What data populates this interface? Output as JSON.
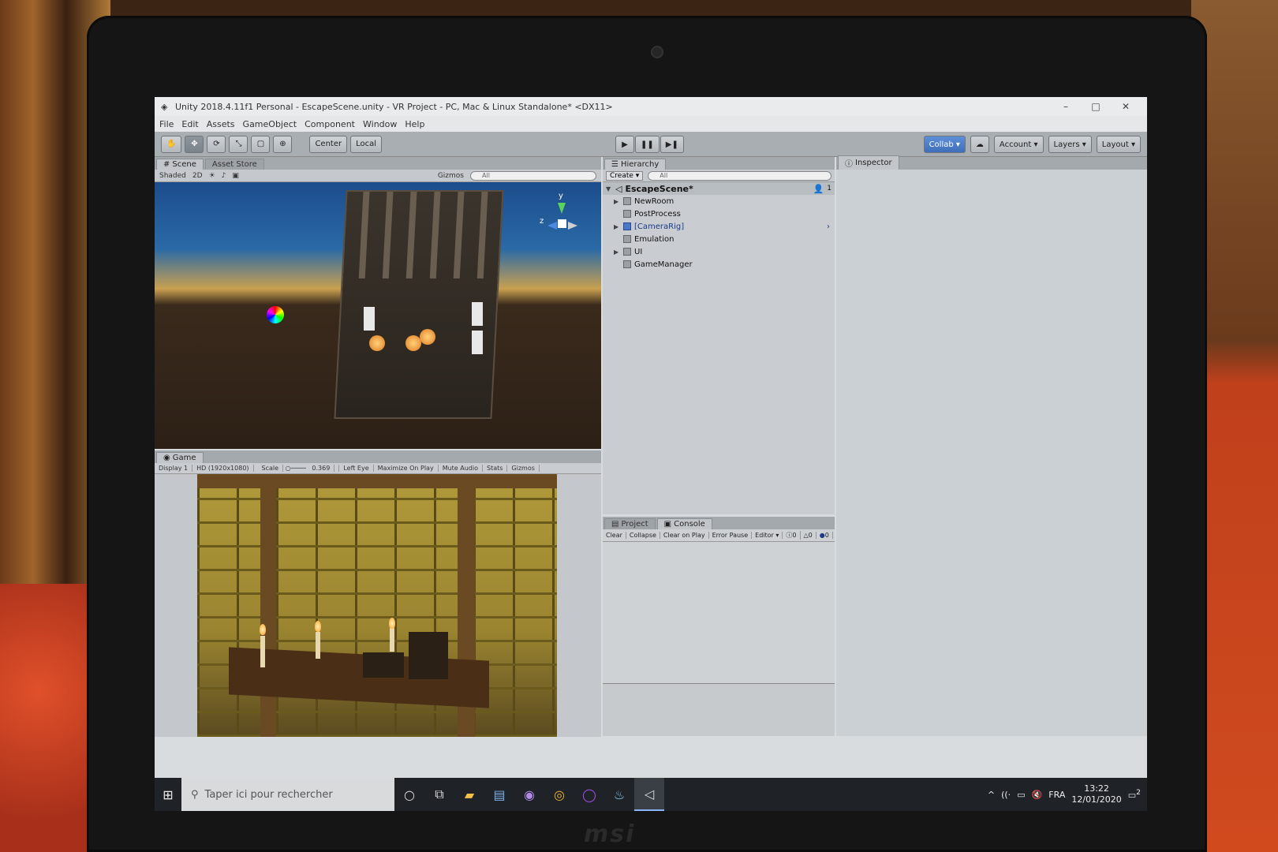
{
  "window": {
    "title": "Unity 2018.4.11f1 Personal - EscapeScene.unity - VR Project - PC, Mac & Linux Standalone* <DX11>",
    "minimize": "–",
    "maximize": "□",
    "close": "✕"
  },
  "menu": [
    "File",
    "Edit",
    "Assets",
    "GameObject",
    "Component",
    "Window",
    "Help"
  ],
  "toolbar": {
    "pivot_label": "Center",
    "space_label": "Local",
    "collab_label": "Collab",
    "account_label": "Account",
    "layers_label": "Layers",
    "layout_label": "Layout"
  },
  "scene": {
    "tab_scene": "Scene",
    "tab_asset_store": "Asset Store",
    "shading_mode": "Shaded",
    "gizmos_label": "Gizmos",
    "search_placeholder": "All",
    "axis_y": "y",
    "axis_z": "z"
  },
  "game": {
    "tab_label": "Game",
    "display": "Display 1",
    "resolution": "HD (1920x1080)",
    "scale_label": "Scale",
    "scale_value": "0.369",
    "eye": "Left Eye",
    "maximize_on_play": "Maximize On Play",
    "mute_audio": "Mute Audio",
    "stats": "Stats",
    "gizmos": "Gizmos"
  },
  "hierarchy": {
    "tab_label": "Hierarchy",
    "create_label": "Create",
    "search_placeholder": "All",
    "scene_name": "EscapeScene*",
    "user_count": "1",
    "items": [
      {
        "label": "NewRoom",
        "expandable": "▶"
      },
      {
        "label": "PostProcess",
        "expandable": ""
      },
      {
        "label": "[CameraRig]",
        "expandable": "▶"
      },
      {
        "label": "Emulation",
        "expandable": ""
      },
      {
        "label": "UI",
        "expandable": "▶"
      },
      {
        "label": "GameManager",
        "expandable": ""
      }
    ]
  },
  "console": {
    "tab_project": "Project",
    "tab_console": "Console",
    "clear": "Clear",
    "collapse": "Collapse",
    "clear_on_play": "Clear on Play",
    "error_pause": "Error Pause",
    "editor": "Editor",
    "log_count": "0",
    "warn_count": "0",
    "error_count": "0"
  },
  "inspector": {
    "tab_label": "Inspector"
  },
  "taskbar": {
    "search_placeholder": "Taper ici pour rechercher",
    "language": "FRA",
    "time": "13:22",
    "date": "12/01/2020",
    "notifications": "2"
  },
  "colors": {
    "accent": "#3f6fb8",
    "panel_bg": "#c9cdd1",
    "taskbar_bg": "#1f2328"
  },
  "brand": "msi"
}
